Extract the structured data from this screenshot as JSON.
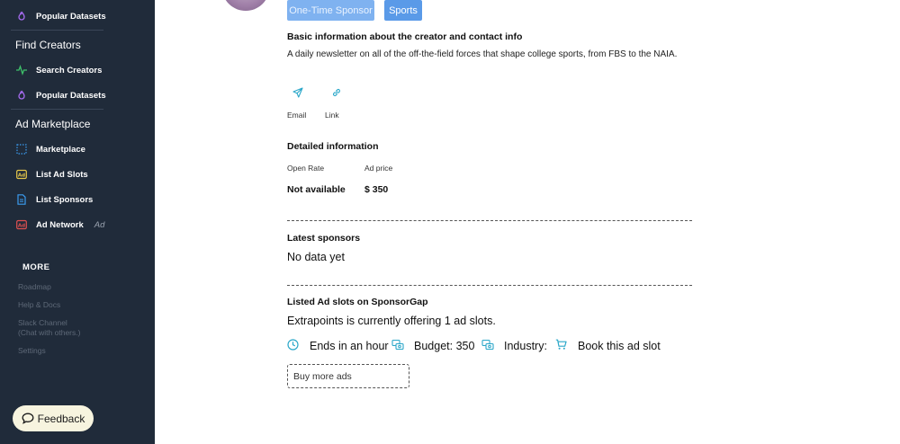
{
  "sidebar": {
    "top_item": {
      "label": "Popular Datasets",
      "icon": "flame-icon"
    },
    "find_creators": {
      "heading": "Find Creators",
      "items": [
        {
          "label": "Search Creators",
          "icon": "activity-icon"
        },
        {
          "label": "Popular Datasets",
          "icon": "flame-icon"
        }
      ]
    },
    "ad_marketplace": {
      "heading": "Ad Marketplace",
      "items": [
        {
          "label": "Marketplace",
          "icon": "dotted-square-icon"
        },
        {
          "label": "List Ad Slots",
          "icon": "ad-badge-icon"
        },
        {
          "label": "List Sponsors",
          "icon": "document-icon"
        },
        {
          "label": "Ad Network",
          "icon": "ad-badge-red-icon",
          "tag": "Ad"
        }
      ]
    },
    "more": {
      "heading": "MORE",
      "links": [
        "Roadmap",
        "Help & Docs",
        "Slack Channel",
        "(Chat with others.)",
        "Settings"
      ]
    },
    "feedback_label": "Feedback"
  },
  "main": {
    "pills": [
      "One-Time Sponsor",
      "Sports"
    ],
    "basic": {
      "heading": "Basic information about the creator and contact info",
      "description": "A daily newsletter on all of the off-the-field forces that shape college sports, from FBS to the NAIA.",
      "contacts": [
        {
          "label": "Email",
          "icon": "send-icon"
        },
        {
          "label": "Link",
          "icon": "link-icon"
        }
      ]
    },
    "detailed": {
      "heading": "Detailed information",
      "open_rate_label": "Open Rate",
      "open_rate_value": "Not available",
      "ad_price_label": "Ad price",
      "ad_price_value": "$ 350"
    },
    "latest_sponsors": {
      "heading": "Latest sponsors",
      "value": "No data yet"
    },
    "ad_slots": {
      "heading": "Listed Ad slots on SponsorGap",
      "summary": "Extrapoints is currently offering 1 ad slots.",
      "ends": "Ends in an hour",
      "budget": "Budget: 350",
      "industry": "Industry:",
      "book": "Book this ad slot",
      "buy_more": "Buy more ads"
    }
  },
  "colors": {
    "sidebar_bg": "#202b3a",
    "pill_light": "#7fb2f0",
    "pill_dark": "#5a9ae8",
    "icon_teal": "#2aa7c9"
  }
}
